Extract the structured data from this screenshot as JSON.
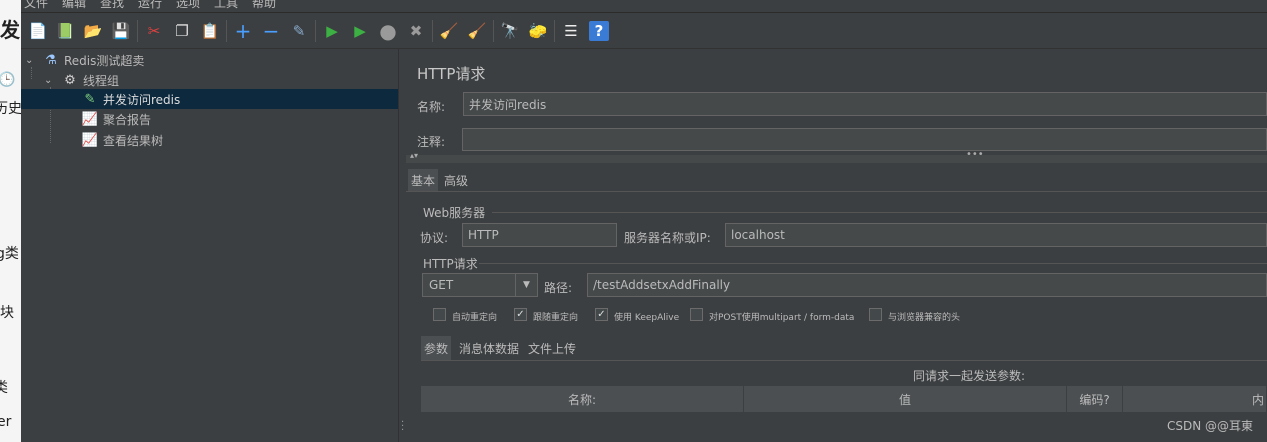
{
  "left_strip": {
    "items": [
      "发",
      "历史",
      "g类",
      "块",
      "类",
      "er"
    ]
  },
  "menu": {
    "items": [
      "文件",
      "编辑",
      "查找",
      "运行",
      "选项",
      "工具",
      "帮助"
    ]
  },
  "toolbar": {
    "buttons": [
      {
        "name": "new-icon",
        "glyph": "📄"
      },
      {
        "name": "templates-icon",
        "glyph": "📗"
      },
      {
        "name": "open-icon",
        "glyph": "📂"
      },
      {
        "name": "save-icon",
        "glyph": "💾"
      },
      {
        "name": "cut-icon",
        "glyph": "✂"
      },
      {
        "name": "copy-icon",
        "glyph": "❐"
      },
      {
        "name": "paste-icon",
        "glyph": "📋"
      },
      {
        "name": "expand-icon",
        "glyph": "+"
      },
      {
        "name": "collapse-icon",
        "glyph": "−"
      },
      {
        "name": "toggle-icon",
        "glyph": "✎"
      },
      {
        "name": "start-icon",
        "glyph": "▶"
      },
      {
        "name": "start-no-pause-icon",
        "glyph": "▶"
      },
      {
        "name": "stop-icon",
        "glyph": "●"
      },
      {
        "name": "shutdown-icon",
        "glyph": "✖"
      },
      {
        "name": "clear-icon",
        "glyph": "🧹"
      },
      {
        "name": "clear-all-icon",
        "glyph": "🧹"
      },
      {
        "name": "search-icon",
        "glyph": "🔭"
      },
      {
        "name": "reset-search-icon",
        "glyph": "🧽"
      },
      {
        "name": "function-helper-icon",
        "glyph": "☰"
      },
      {
        "name": "help-icon",
        "glyph": "?"
      }
    ]
  },
  "tree": {
    "items": [
      {
        "label": "Redis测试超卖",
        "icon": "flask-icon"
      },
      {
        "label": "线程组",
        "icon": "gear-icon"
      },
      {
        "label": "并发访问redis",
        "icon": "pipette-icon"
      },
      {
        "label": "聚合报告",
        "icon": "chart-icon"
      },
      {
        "label": "查看结果树",
        "icon": "chart-icon"
      }
    ]
  },
  "panel": {
    "title": "HTTP请求",
    "name_label": "名称:",
    "name_value": "并发访问redis",
    "comment_label": "注释:",
    "comment_value": "",
    "tabs": [
      "基本",
      "高级"
    ],
    "web_server": {
      "group_title": "Web服务器",
      "protocol_label": "协议:",
      "protocol_value": "HTTP",
      "server_label": "服务器名称或IP:",
      "server_value": "localhost"
    },
    "http_request": {
      "group_title": "HTTP请求",
      "method": "GET",
      "path_label": "路径:",
      "path_value": "/testAddsetxAddFinally"
    },
    "options": [
      {
        "label": "自动重定向",
        "checked": false
      },
      {
        "label": "跟随重定向",
        "checked": true
      },
      {
        "label": "使用 KeepAlive",
        "checked": true
      },
      {
        "label": "对POST使用multipart / form-data",
        "checked": false
      },
      {
        "label": "与浏览器兼容的头",
        "checked": false
      }
    ],
    "sub_tabs": [
      "参数",
      "消息体数据",
      "文件上传"
    ],
    "params_caption": "同请求一起发送参数:",
    "columns": [
      "名称:",
      "值",
      "编码?",
      "内"
    ]
  },
  "watermark": "CSDN @@耳東"
}
